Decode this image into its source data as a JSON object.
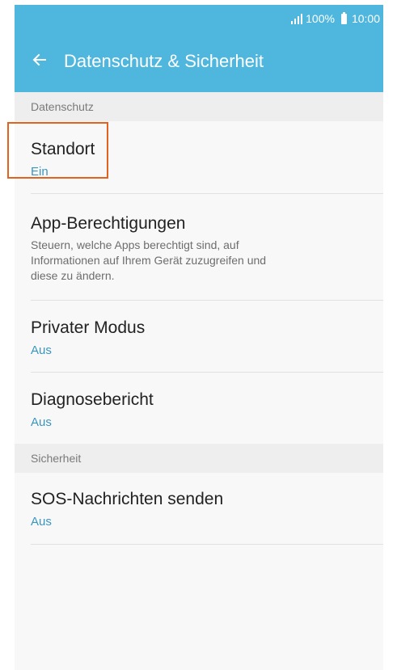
{
  "status_bar": {
    "battery": "100%",
    "time": "10:00"
  },
  "app_bar": {
    "title": "Datenschutz & Sicherheit",
    "back_icon": "arrow-left-icon"
  },
  "sections": {
    "privacy": {
      "header": "Datenschutz",
      "items": {
        "location": {
          "title": "Standort",
          "value": "Ein"
        },
        "app_permissions": {
          "title": "App-Berechtigungen",
          "description_lines": [
            "Steuern, welche Apps berechtigt sind, auf",
            "Informationen auf Ihrem Gerät zuzugreifen und",
            "diese zu ändern."
          ]
        },
        "private_mode": {
          "title": "Privater Modus",
          "value": "Aus"
        },
        "diagnostics": {
          "title": "Diagnosebericht",
          "value": "Aus"
        }
      }
    },
    "security": {
      "header": "Sicherheit",
      "items": {
        "sos": {
          "title": "SOS-Nachrichten senden",
          "value": "Aus"
        }
      }
    }
  },
  "colors": {
    "accent": "#4fb7de",
    "value_text": "#3a96bd",
    "highlight": "#e2631f"
  }
}
